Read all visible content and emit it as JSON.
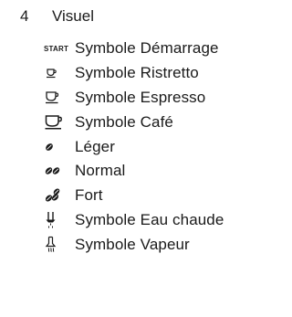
{
  "section": {
    "number": "4",
    "title": "Visuel"
  },
  "items": [
    {
      "icon": "start-text-icon",
      "icon_text": "START",
      "label": "Symbole Démarrage"
    },
    {
      "icon": "cup-small-icon",
      "label": "Symbole Ristretto"
    },
    {
      "icon": "cup-medium-icon",
      "label": "Symbole Espresso"
    },
    {
      "icon": "cup-large-icon",
      "label": "Symbole Café"
    },
    {
      "icon": "bean-one-icon",
      "label": "Léger"
    },
    {
      "icon": "bean-two-icon",
      "label": "Normal"
    },
    {
      "icon": "bean-three-icon",
      "label": "Fort"
    },
    {
      "icon": "hot-water-icon",
      "label": "Symbole Eau chaude"
    },
    {
      "icon": "steam-icon",
      "label": "Symbole Vapeur"
    }
  ]
}
